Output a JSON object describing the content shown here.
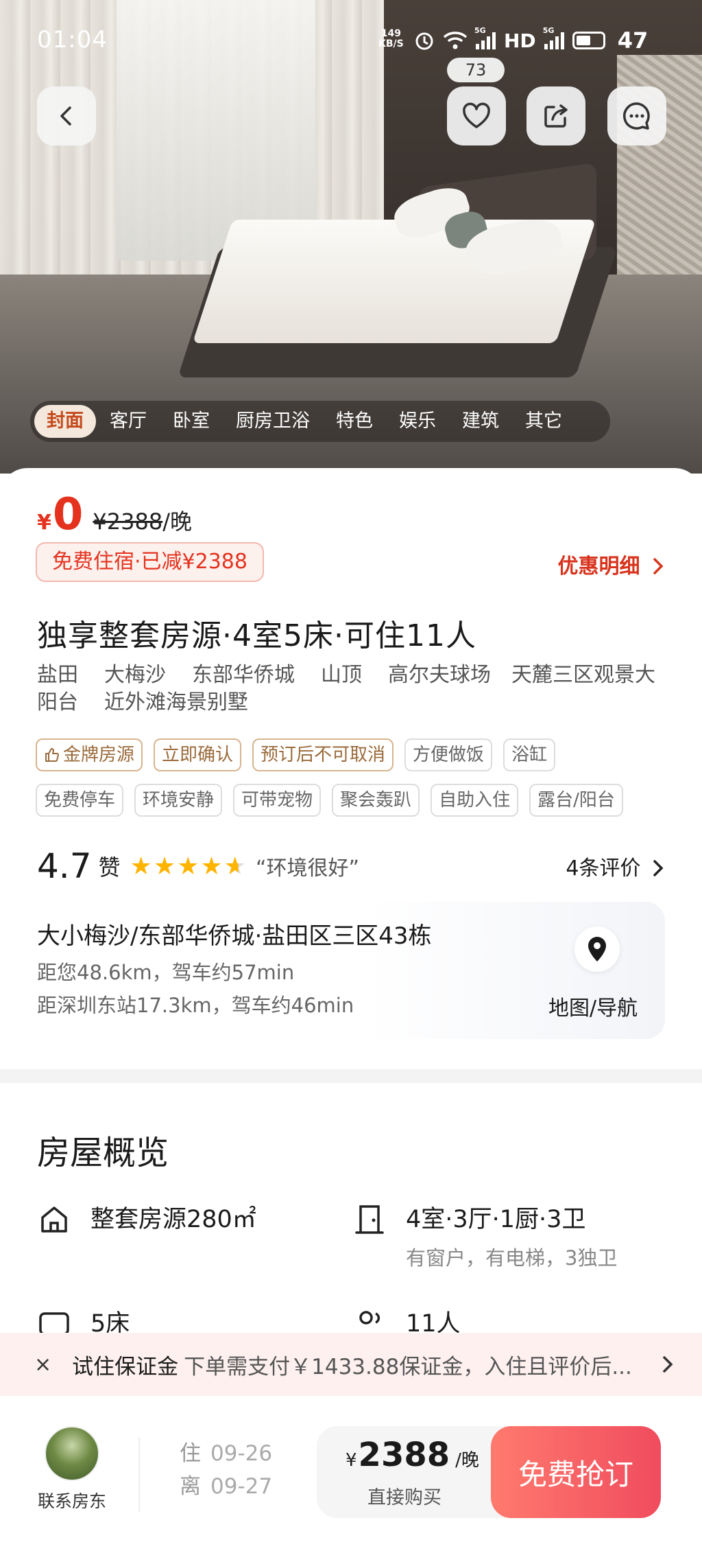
{
  "status_bar": {
    "time": "01:04",
    "net_speed_value": "149",
    "net_speed_unit": "KB/S",
    "network_1": "5G",
    "network_hd": "HD",
    "network_2": "5G",
    "battery": "47"
  },
  "hero": {
    "favorite_count": "73",
    "gallery_tabs": [
      "封面",
      "客厅",
      "卧室",
      "厨房卫浴",
      "特色",
      "娱乐",
      "建筑",
      "其它"
    ],
    "active_tab": "封面"
  },
  "price": {
    "currency": "¥",
    "now": "0",
    "original": "¥2388",
    "unit": "/晚",
    "free_badge": "免费住宿·已减¥2388",
    "discount_link": "优惠明细"
  },
  "listing": {
    "title": "独享整套房源·4室5床·可住11人",
    "location_tags": [
      "盐田",
      "大梅沙",
      "东部华侨城",
      "山顶",
      "高尔夫球场",
      "天麓三区观景大阳台",
      "近外滩海景别墅"
    ],
    "feature_chips_row1": [
      "金牌房源",
      "立即确认",
      "预订后不可取消",
      "方便做饭",
      "浴缸"
    ],
    "feature_chips_row2": [
      "免费停车",
      "环境安静",
      "可带宠物",
      "聚会轰趴",
      "自助入住",
      "露台/阳台"
    ]
  },
  "rating": {
    "score": "4.7",
    "label": "赞",
    "stars": 4.7,
    "quote": "“环境很好”",
    "reviews_link": "4条评价"
  },
  "location": {
    "address": "大小梅沙/东部华侨城·盐田区三区43栋",
    "distance_user": "距您48.6km，驾车约57min",
    "distance_station": "距深圳东站17.3km，驾车约46min",
    "map_label": "地图/导航"
  },
  "overview": {
    "title": "房屋概览",
    "items": [
      {
        "icon": "house-icon",
        "main": "整套房源280㎡",
        "sub": ""
      },
      {
        "icon": "door-icon",
        "main": "4室·3厅·1厨·3卫",
        "sub": "有窗户，有电梯，3独卫"
      },
      {
        "icon": "bed-icon",
        "main": "5床",
        "sub": ""
      },
      {
        "icon": "people-icon",
        "main": "11人",
        "sub": ""
      }
    ]
  },
  "deposit_banner": {
    "close": "×",
    "label": "试住保证金",
    "text": "下单需支付￥1433.88保证金，入住且评价后..."
  },
  "bottom_bar": {
    "host_label": "联系房东",
    "checkin_key": "住",
    "checkin_date": "09-26",
    "checkout_key": "离",
    "checkout_date": "09-27",
    "buy_currency": "¥",
    "buy_price": "2388",
    "buy_unit": "/晚",
    "buy_label": "直接购买",
    "book_button": "免费抢订"
  },
  "colors": {
    "accent_red": "#e4321e",
    "book_gradient_start": "#ff7a6e",
    "book_gradient_end": "#f04c5e",
    "star": "#ffb400"
  }
}
